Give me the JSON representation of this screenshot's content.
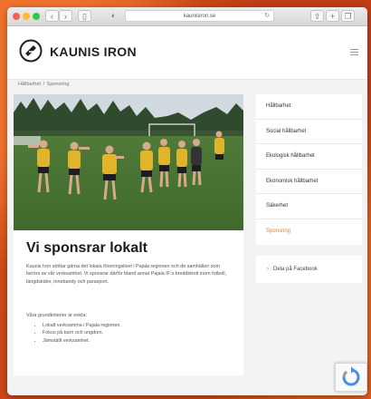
{
  "browser": {
    "url": "kaunisiron.se",
    "back_icon": "chevron-left-icon",
    "forward_icon": "chevron-right-icon"
  },
  "site": {
    "brand": "KAUNIS IRON",
    "accent": "#e8822f"
  },
  "breadcrumb": {
    "items": [
      "Hållbarhet",
      "Sponsring"
    ],
    "separator": "/"
  },
  "article": {
    "title": "Vi sponsrar lokalt",
    "paragraph1": "Kaunis Iron stöttar gärna det lokala föreningslivet i Pajala regionen och de samhällen som berörs av vår verksamhet. Vi sponsrar därför bland annat Pajala IF:s breddidrott inom fotboll, längdskidor, innebandy och parasport.",
    "paragraph2": "Våra grundkriterier är enkla:",
    "bullets": [
      "Lokalt verksamma i Pajala regionen.",
      "Fokus på barn och ungdom.",
      "Jämställt verksamhet."
    ]
  },
  "sidebar": {
    "items": [
      {
        "label": "Hållbarhet"
      },
      {
        "label": "Social hållbarhet"
      },
      {
        "label": "Ekologisk hållbarhet"
      },
      {
        "label": "Ekonomisk hållbarhet"
      },
      {
        "label": "Säkerhet"
      },
      {
        "label": "Sponsring",
        "active": true
      }
    ]
  },
  "share": {
    "label": "Dela på Facebook"
  }
}
